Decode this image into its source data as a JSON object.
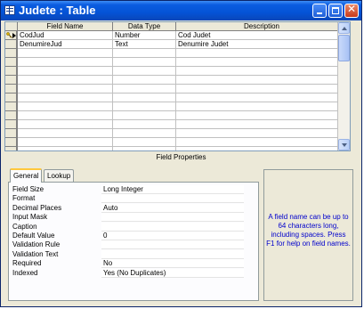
{
  "window": {
    "title": "Judete : Table",
    "minimize_glyph": "",
    "maximize_glyph": "",
    "close_glyph": "✕"
  },
  "grid": {
    "columns": [
      "Field Name",
      "Data Type",
      "Description"
    ],
    "rows": [
      {
        "field_name": "CodJud",
        "data_type": "Number",
        "description": "Cod Judet",
        "primary_key": true,
        "current": true
      },
      {
        "field_name": "DenumireJud",
        "data_type": "Text",
        "description": "Denumire Judet",
        "primary_key": false,
        "current": false
      }
    ]
  },
  "field_properties": {
    "title": "Field Properties",
    "tabs": [
      {
        "label": "General",
        "active": true
      },
      {
        "label": "Lookup",
        "active": false
      }
    ],
    "properties": [
      {
        "name": "Field Size",
        "value": "Long Integer"
      },
      {
        "name": "Format",
        "value": ""
      },
      {
        "name": "Decimal Places",
        "value": "Auto"
      },
      {
        "name": "Input Mask",
        "value": ""
      },
      {
        "name": "Caption",
        "value": ""
      },
      {
        "name": "Default Value",
        "value": "0"
      },
      {
        "name": "Validation Rule",
        "value": ""
      },
      {
        "name": "Validation Text",
        "value": ""
      },
      {
        "name": "Required",
        "value": "No"
      },
      {
        "name": "Indexed",
        "value": "Yes (No Duplicates)"
      }
    ],
    "help_text": "A field name can be up to 64 characters long, including spaces.  Press F1 for help on field names."
  },
  "colors": {
    "titlebar": "#0453d6",
    "help_text": "#0000cc",
    "active_tab_accent": "#ffc83c"
  },
  "icons": {
    "window": "table-icon",
    "primary_key": "key-icon",
    "current_row": "row-pointer-icon"
  }
}
